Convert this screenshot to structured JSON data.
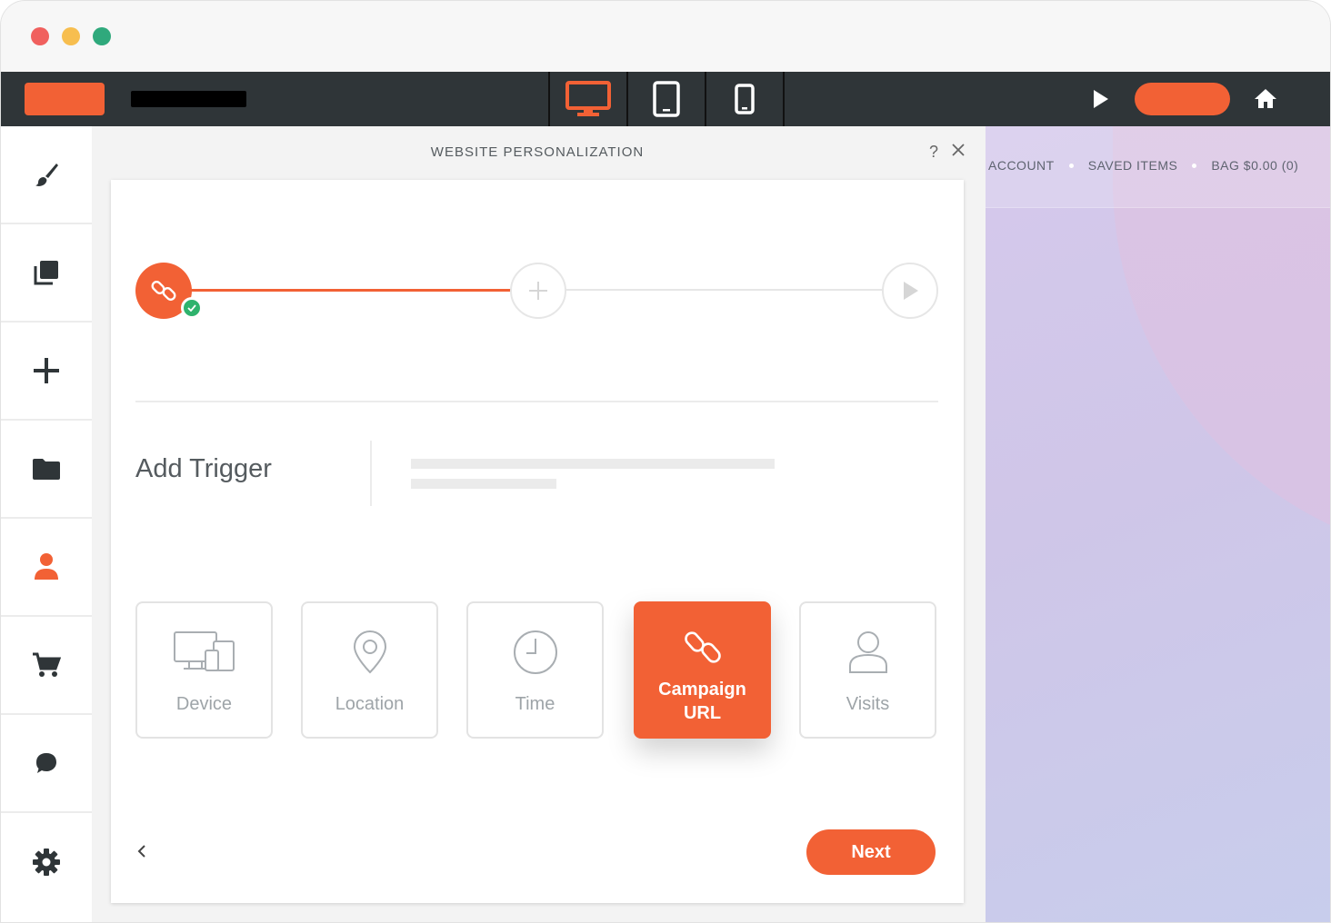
{
  "panel": {
    "title": "WEBSITE PERSONALIZATION",
    "help_label": "?"
  },
  "stepper": {
    "steps": [
      {
        "name": "campaign-url",
        "state": "complete",
        "icon": "link-icon"
      },
      {
        "name": "add",
        "state": "pending",
        "icon": "plus-icon"
      },
      {
        "name": "preview",
        "state": "pending",
        "icon": "play-icon"
      }
    ]
  },
  "trigger": {
    "heading": "Add Trigger",
    "options": [
      {
        "label": "Device",
        "icon": "devices-icon",
        "selected": false
      },
      {
        "label": "Location",
        "icon": "location-pin-icon",
        "selected": false
      },
      {
        "label": "Time",
        "icon": "clock-icon",
        "selected": false
      },
      {
        "label": "Campaign URL",
        "icon": "link-icon",
        "selected": true
      },
      {
        "label": "Visits",
        "icon": "user-icon",
        "selected": false
      }
    ]
  },
  "actions": {
    "next_label": "Next"
  },
  "preview": {
    "nav": [
      "ACCOUNT",
      "SAVED ITEMS",
      "BAG $0.00 (0)"
    ]
  },
  "toolbar": {
    "device_modes": [
      "desktop",
      "tablet",
      "mobile"
    ],
    "active_device": "desktop"
  },
  "sidebar": {
    "items": [
      "brush-icon",
      "pages-icon",
      "plus-icon",
      "folder-icon",
      "user-icon",
      "cart-icon",
      "chat-icon",
      "gear-icon"
    ],
    "active": "user-icon"
  },
  "colors": {
    "accent": "#f26135",
    "toolbar": "#2f3538",
    "success": "#2fb36d"
  }
}
